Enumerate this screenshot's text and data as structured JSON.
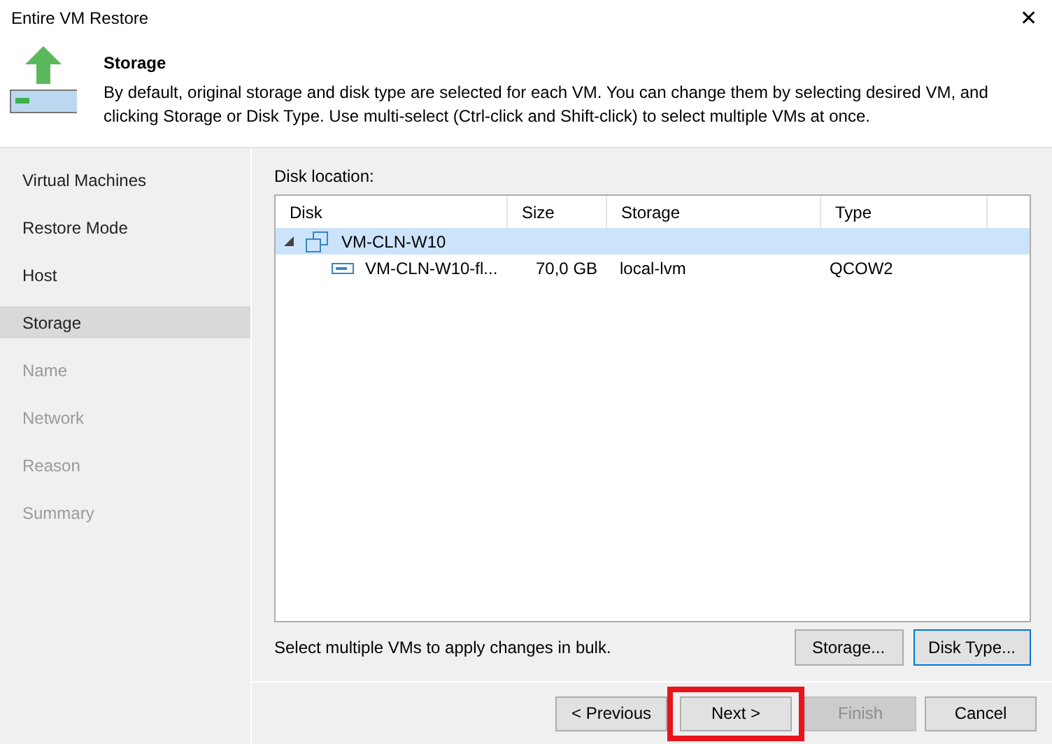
{
  "window": {
    "title": "Entire VM Restore",
    "close": "✕"
  },
  "header": {
    "title": "Storage",
    "description": "By default, original storage and disk type are selected for each VM. You can change them by selecting desired VM, and clicking Storage or Disk Type. Use multi-select (Ctrl-click and Shift-click) to select multiple VMs at once."
  },
  "sidebar": {
    "items": [
      {
        "label": "Virtual Machines",
        "selected": false,
        "disabled": false
      },
      {
        "label": "Restore Mode",
        "selected": false,
        "disabled": false
      },
      {
        "label": "Host",
        "selected": false,
        "disabled": false
      },
      {
        "label": "Storage",
        "selected": true,
        "disabled": false
      },
      {
        "label": "Name",
        "selected": false,
        "disabled": true
      },
      {
        "label": "Network",
        "selected": false,
        "disabled": true
      },
      {
        "label": "Reason",
        "selected": false,
        "disabled": true
      },
      {
        "label": "Summary",
        "selected": false,
        "disabled": true
      }
    ]
  },
  "disk_location": {
    "label": "Disk location:",
    "table": {
      "columns": [
        "Disk",
        "Size",
        "Storage",
        "Type"
      ],
      "rows": [
        {
          "kind": "vm",
          "name": "VM-CLN-W10",
          "expanded": true,
          "selected": true,
          "children": [
            {
              "kind": "disk",
              "name": "VM-CLN-W10-fl...",
              "size": "70,0 GB",
              "storage": "local-lvm",
              "type": "QCOW2",
              "selected": false
            }
          ]
        }
      ]
    },
    "hint": "Select multiple VMs to apply changes in bulk.",
    "buttons": [
      {
        "label": "Storage...",
        "focused": false
      },
      {
        "label": "Disk Type...",
        "focused": true
      }
    ]
  },
  "footer": {
    "buttons": [
      {
        "label": "< Previous",
        "disabled": false,
        "highlighted": false
      },
      {
        "label": "Next >",
        "disabled": false,
        "highlighted": true
      },
      {
        "label": "Finish",
        "disabled": true,
        "highlighted": false
      },
      {
        "label": "Cancel",
        "disabled": false,
        "highlighted": false
      }
    ]
  }
}
